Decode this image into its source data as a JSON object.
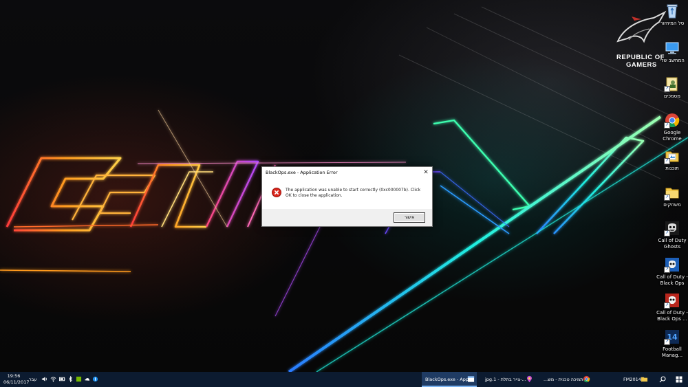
{
  "desktop": {
    "rog_logo_lines": [
      "REPUBLIC OF",
      "GAMERS"
    ],
    "icons": [
      {
        "label": "סל המיחזור",
        "icon": "recycle-bin-icon"
      },
      {
        "label": "המחשב שלי",
        "icon": "this-pc-icon"
      },
      {
        "label": "מסמכים",
        "icon": "documents-icon"
      },
      {
        "label": "Google Chrome",
        "icon": "chrome-icon"
      },
      {
        "label": "תוכנות",
        "icon": "folder-icon"
      },
      {
        "label": "משחקים",
        "icon": "folder-icon"
      },
      {
        "label": "Call of Duty Ghosts",
        "icon": "cod-ghosts-icon"
      },
      {
        "label": "Call of Duty - Black Ops",
        "icon": "cod-blackops-icon"
      },
      {
        "label": "Call of Duty - Black Ops ...",
        "icon": "cod-blackops2-icon"
      },
      {
        "label": "Football Manag...",
        "icon": "football-manager-icon"
      }
    ]
  },
  "dialog": {
    "title": "BlackOps.exe - Application Error",
    "message": "The application was unable to start correctly (0xc000007b). Click OK to close the application.",
    "ok_label": "אישור",
    "close_glyph": "✕"
  },
  "taskbar": {
    "clock_time": "19:56",
    "clock_date": "06/11/2017",
    "language": "עבר",
    "items": [
      {
        "label": "BlackOps.exe - App...",
        "icon": "app-window-icon",
        "active": true
      },
      {
        "label": "jpg.1 - צייר בתלת-...",
        "icon": "paint3d-icon",
        "active": false
      },
      {
        "label": "תמיכה טכנית - מש...",
        "icon": "chrome-icon",
        "active": false
      },
      {
        "label": "FM2014",
        "icon": "folder-icon",
        "active": false
      }
    ],
    "colors": {
      "background": "#0c1b30",
      "active": "#1f3b63"
    }
  }
}
